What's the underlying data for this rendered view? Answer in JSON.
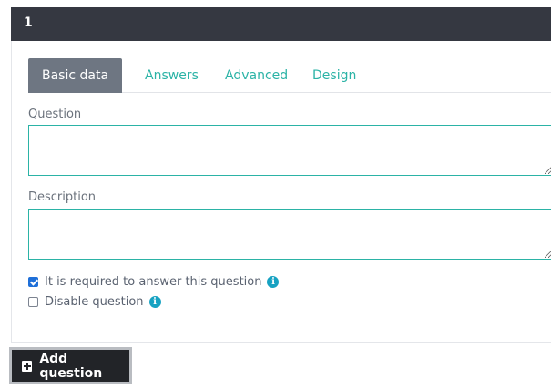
{
  "question": {
    "number": "1",
    "tabs": [
      {
        "label": "Basic data",
        "active": true
      },
      {
        "label": "Answers",
        "active": false
      },
      {
        "label": "Advanced",
        "active": false
      },
      {
        "label": "Design",
        "active": false
      }
    ],
    "question_label": "Question",
    "question_value": "",
    "description_label": "Description",
    "description_value": "",
    "required": {
      "label": "It is required to answer this question",
      "checked": true,
      "icon": "info-icon"
    },
    "disable": {
      "label": "Disable question",
      "checked": false,
      "icon": "info-icon"
    }
  },
  "add_question": {
    "label": "Add question",
    "icon": "plus-square-icon"
  },
  "colors": {
    "header_bg": "#353841",
    "accent": "#2bb3a6",
    "active_tab_bg": "#6e7682",
    "info": "#17a2c2",
    "checkbox": "#1f6fd8"
  }
}
